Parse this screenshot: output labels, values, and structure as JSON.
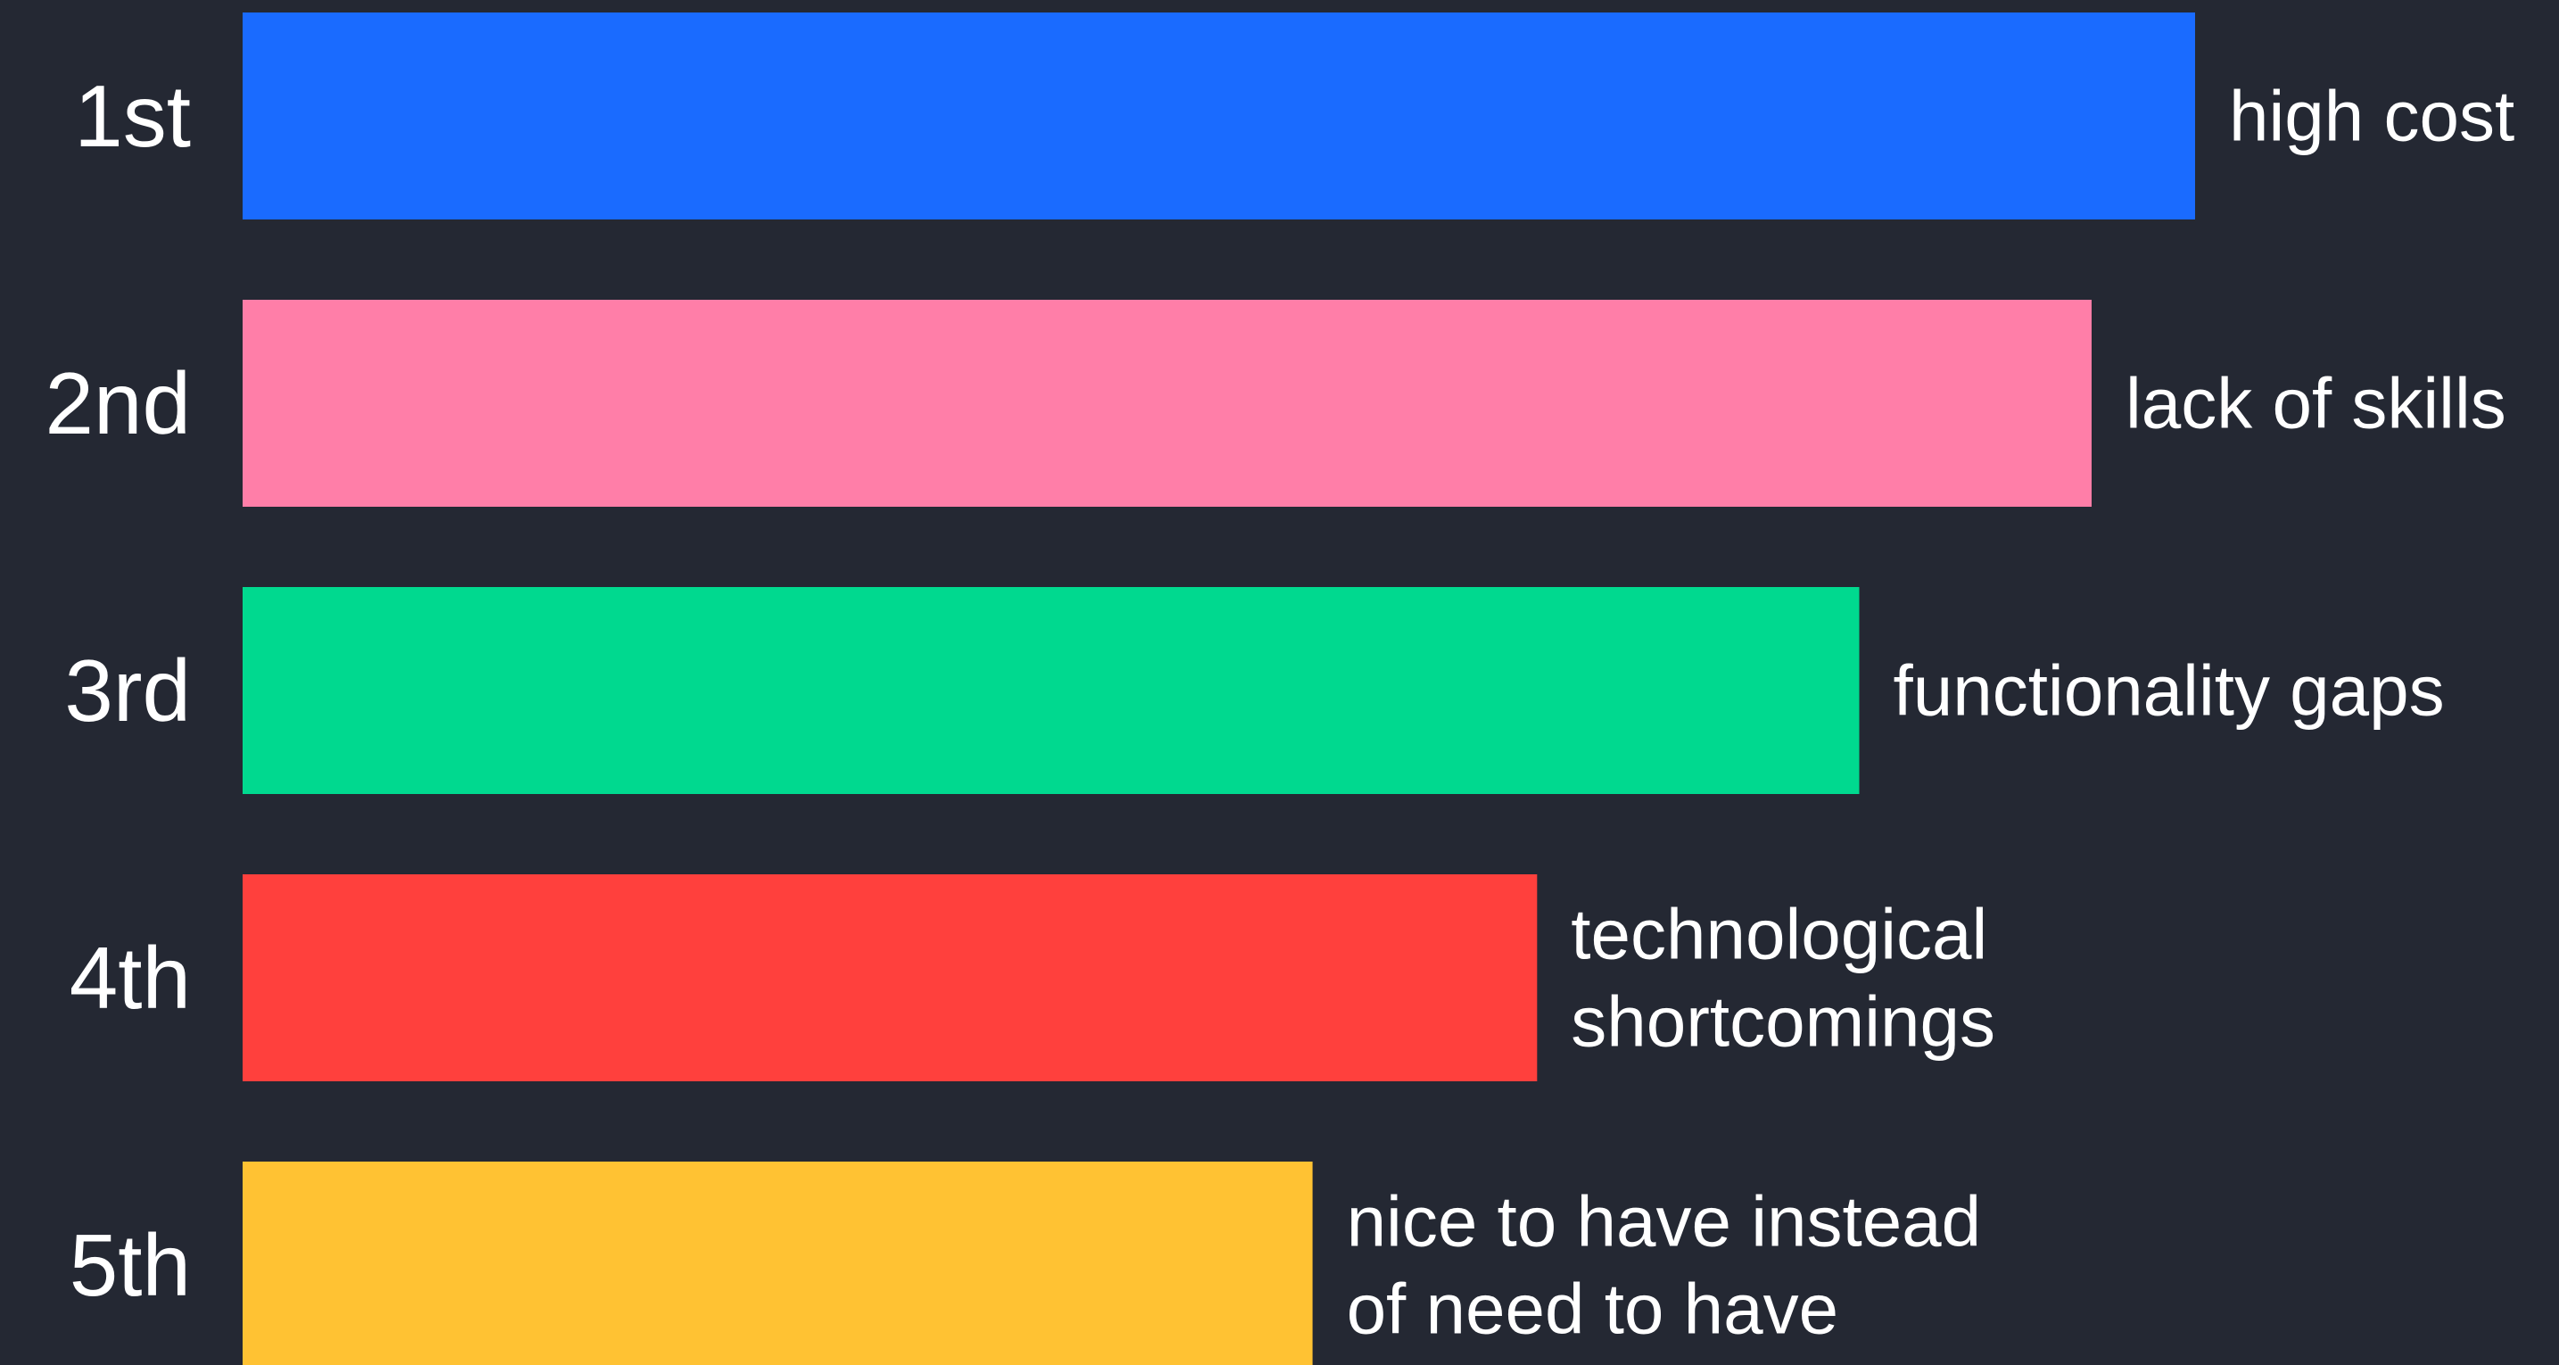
{
  "chart_data": {
    "type": "bar",
    "orientation": "horizontal",
    "ranks": [
      "1st",
      "2nd",
      "3rd",
      "4th",
      "5th"
    ],
    "categories": [
      [
        "high cost"
      ],
      [
        "lack of skills"
      ],
      [
        "functionality gaps"
      ],
      [
        "technological",
        "shortcomings"
      ],
      [
        "nice to have instead",
        "of need to have"
      ]
    ],
    "values": [
      100,
      94.7,
      82.8,
      66.3,
      54.8
    ],
    "value_unit": "percent of top bar length",
    "colors": [
      "#1a6bff",
      "#ff7ea8",
      "#00d98f",
      "#ff403d",
      "#ffc233"
    ],
    "background": "#242833",
    "text_color": "#ffffff",
    "xlim": [
      0,
      100
    ],
    "grid": false,
    "legend": "none",
    "title": "",
    "xlabel": "",
    "ylabel": ""
  }
}
